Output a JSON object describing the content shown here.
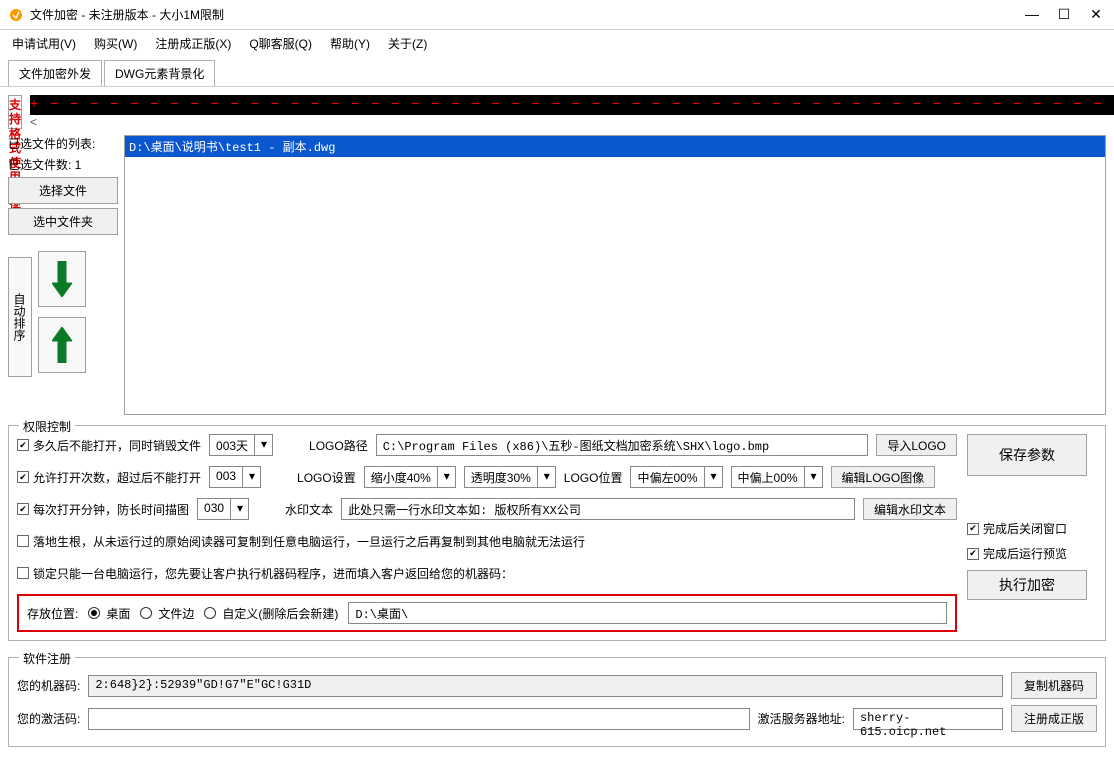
{
  "title": "文件加密 - 未注册版本 - 大小1M限制",
  "menu": [
    "申请试用(V)",
    "购买(W)",
    "注册成正版(X)",
    "Q聊客服(Q)",
    "帮助(Y)",
    "关于(Z)"
  ],
  "tabs": [
    "文件加密外发",
    "DWG元素背景化"
  ],
  "support_btn_l1": "支持格式",
  "support_btn_l2": "使用必读",
  "file_list_label": "已选文件的列表:",
  "file_count_label": "已选文件数: 1",
  "btn_select_files": "选择文件",
  "btn_select_folder": "选中文件夹",
  "btn_auto_sort": "自动排序",
  "file_items": [
    "D:\\桌面\\说明书\\test1 - 副本.dwg"
  ],
  "perm_legend": "权限控制",
  "perm": {
    "days_label": "多久后不能打开，同时销毁文件",
    "days_value": "003天",
    "count_label": "允许打开次数，超过后不能打开",
    "count_value": "003",
    "mins_label": "每次打开分钟，防长时间描图",
    "mins_value": "030",
    "root_label": "落地生根，从未运行过的原始阅读器可复制到任意电脑运行，一旦运行之后再复制到其他电脑就无法运行",
    "lock_label": "锁定只能一台电脑运行，您先要让客户执行机器码程序，进而填入客户返回给您的机器码："
  },
  "logo": {
    "path_label": "LOGO路径",
    "path_value": "C:\\Program Files (x86)\\五秒-图纸文档加密系统\\SHX\\logo.bmp",
    "set_label": "LOGO设置",
    "scale": "缩小度40%",
    "alpha": "透明度30%",
    "pos_label": "LOGO位置",
    "pos_left": "中偏左00%",
    "pos_top": "中偏上00%",
    "import_btn": "导入LOGO",
    "edit_btn": "编辑LOGO图像",
    "wm_label": "水印文本",
    "wm_value": "此处只需一行水印文本如: 版权所有XX公司",
    "wm_btn": "编辑水印文本"
  },
  "save_param_btn": "保存参数",
  "cb_close_after": "完成后关闭窗口",
  "cb_preview_after": "完成后运行预览",
  "exec_btn": "执行加密",
  "savepos": {
    "label": "存放位置:",
    "opt1": "桌面",
    "opt2": "文件边",
    "opt3": "自定义(删除后会新建)",
    "path": "D:\\桌面\\"
  },
  "reg_legend": "软件注册",
  "reg": {
    "machine_label": "您的机器码:",
    "machine_value": "2:648}2}:52939\"GD!G7\"E\"GC!G31D",
    "copy_btn": "复制机器码",
    "act_label": "您的激活码:",
    "server_label": "激活服务器地址:",
    "server_value": "sherry-615.oicp.net",
    "reg_btn": "注册成正版"
  }
}
